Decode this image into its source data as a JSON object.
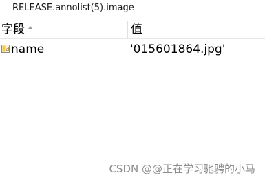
{
  "window": {
    "title": "RELEASE.annolist(5).image"
  },
  "table": {
    "columns": [
      "字段",
      "值"
    ],
    "rows": [
      {
        "field": "name",
        "value": "'015601864.jpg'",
        "icon": "char-array-icon"
      }
    ]
  },
  "watermark": "CSDN @@正在学习驰骋的小马"
}
